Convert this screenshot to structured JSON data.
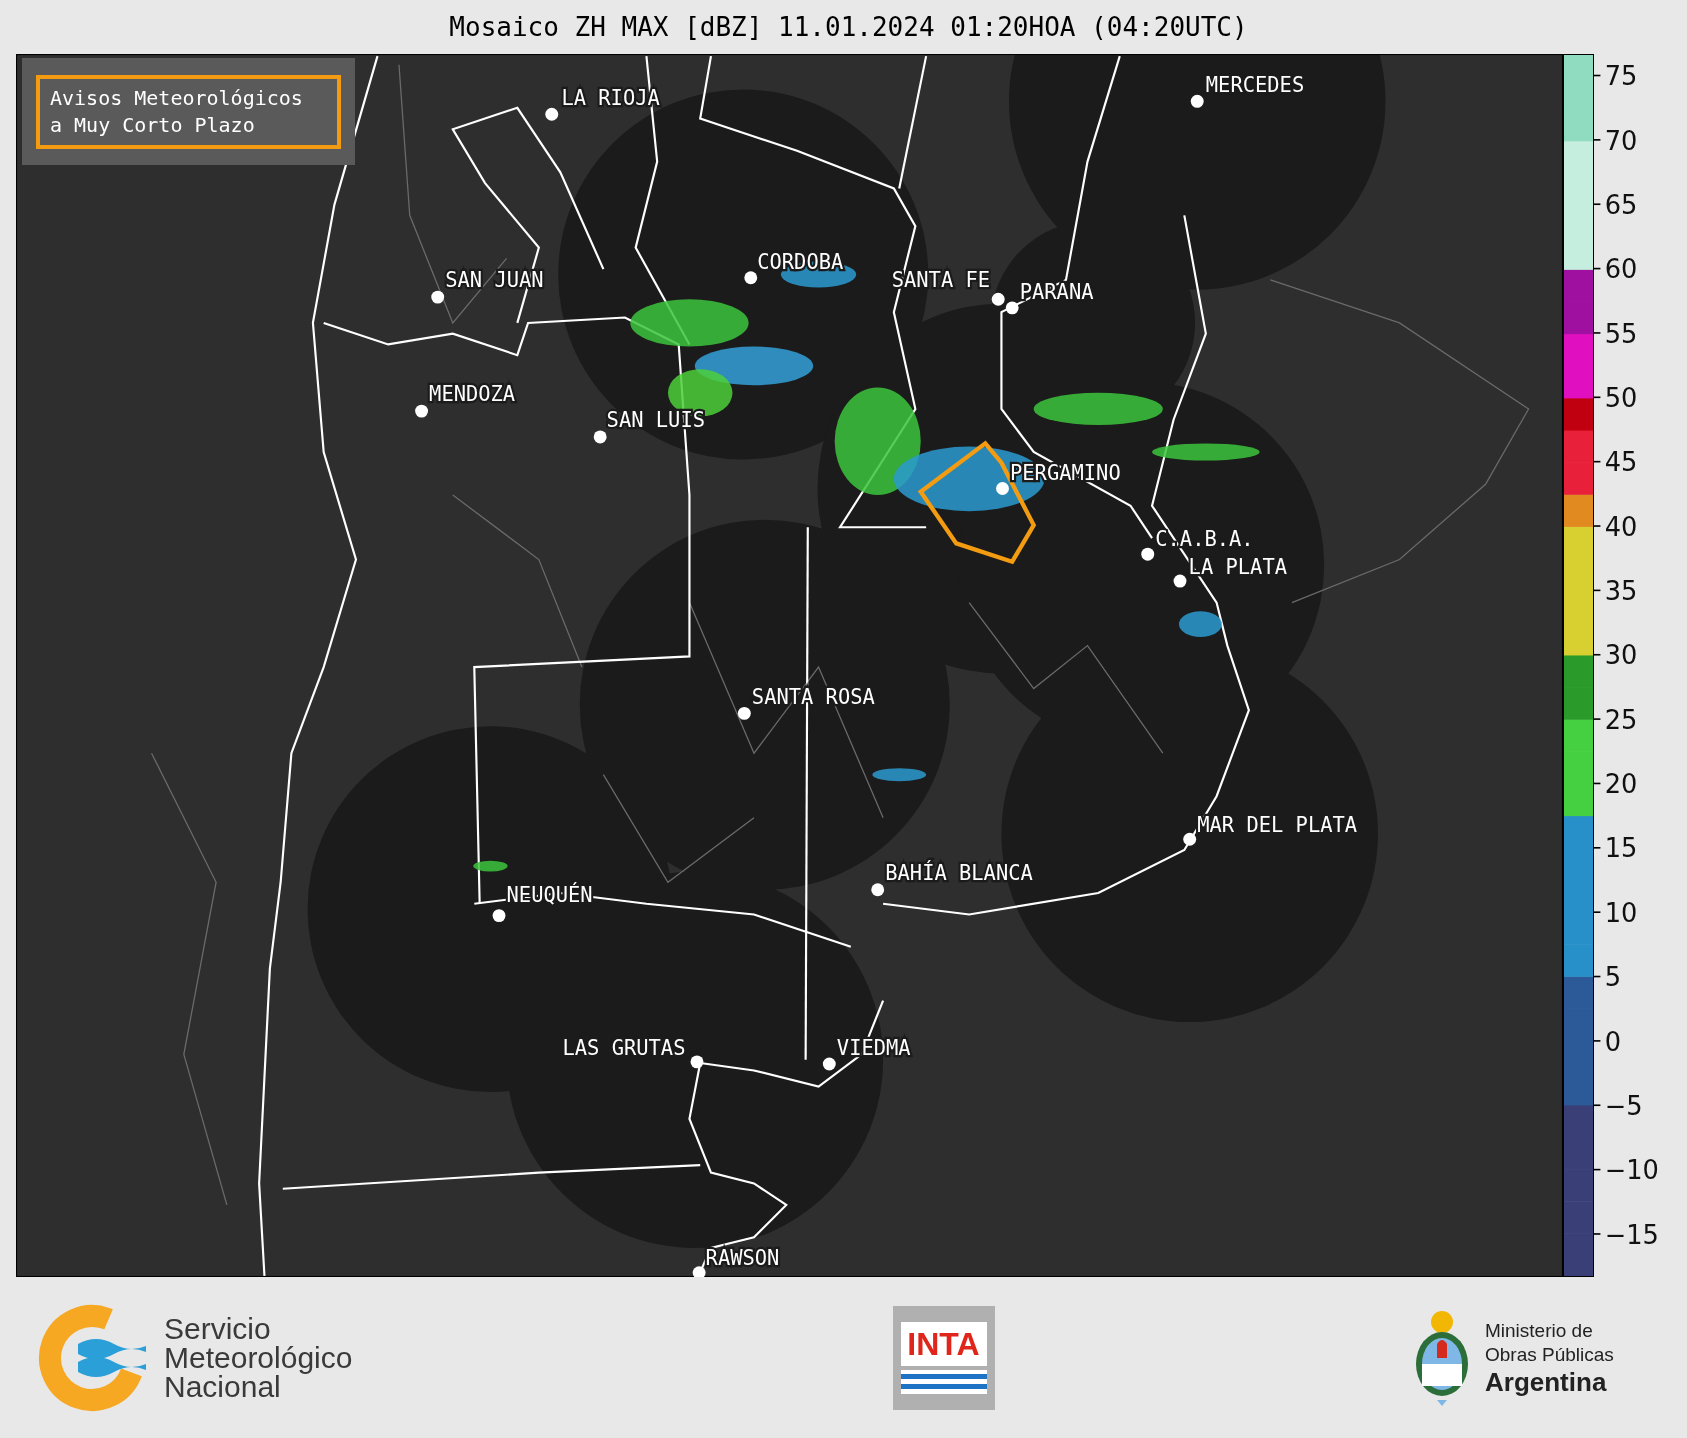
{
  "title": "Mosaico ZH MAX [dBZ] 11.01.2024 01:20HOA (04:20UTC)",
  "warning_box": {
    "lines": [
      "Avisos Meteorológicos",
      "a Muy Corto Plazo"
    ]
  },
  "map": {
    "cities": [
      {
        "name": "LA RIOJA"
      },
      {
        "name": "MERCEDES"
      },
      {
        "name": "CORDOBA"
      },
      {
        "name": "SAN JUAN"
      },
      {
        "name": "SANTA FE"
      },
      {
        "name": "PARANA"
      },
      {
        "name": "MENDOZA"
      },
      {
        "name": "SAN LUIS"
      },
      {
        "name": "PERGAMINO"
      },
      {
        "name": "C.A.B.A."
      },
      {
        "name": "LA PLATA"
      },
      {
        "name": "SANTA ROSA"
      },
      {
        "name": "MAR DEL PLATA"
      },
      {
        "name": "BAHÍA BLANCA"
      },
      {
        "name": "NEUQUÉN"
      },
      {
        "name": "LAS GRUTAS"
      },
      {
        "name": "VIEDMA"
      },
      {
        "name": "RAWSON"
      }
    ]
  },
  "colorbar": {
    "ticks": [
      "75",
      "70",
      "65",
      "60",
      "55",
      "50",
      "45",
      "40",
      "35",
      "30",
      "25",
      "20",
      "15",
      "10",
      "5",
      "0",
      "−5",
      "−10",
      "−15"
    ]
  },
  "footer": {
    "smn": {
      "lines": [
        "Servicio",
        "Meteorológico",
        "Nacional"
      ]
    },
    "inta": {
      "label": "INTA"
    },
    "ministry": {
      "lines": [
        "Ministerio de",
        "Obras Públicas"
      ],
      "country": "Argentina"
    }
  }
}
